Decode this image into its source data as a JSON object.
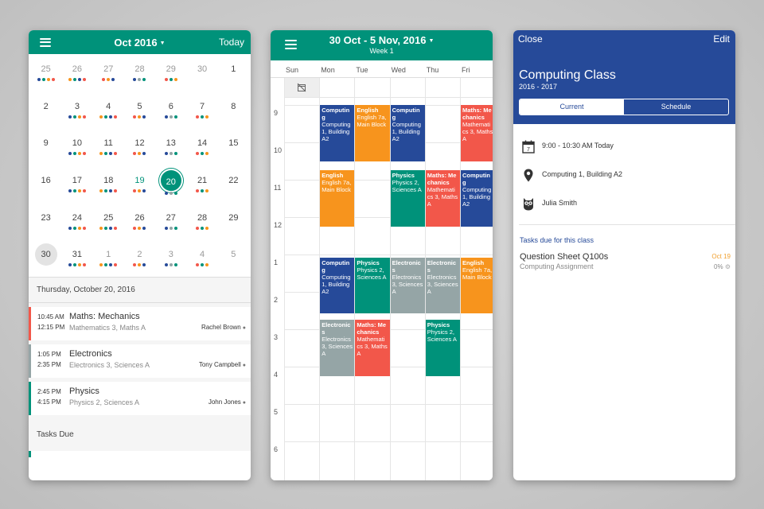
{
  "colors": {
    "teal": "#00927a",
    "navy": "#264a99",
    "orange": "#f7941d",
    "red": "#f2574a",
    "green": "#00927a",
    "grey": "#95a5a6",
    "blue": "#264a99"
  },
  "month_view": {
    "title": "Oct 2016",
    "today_label": "Today",
    "days": [
      {
        "n": "25",
        "other": true,
        "dots": [
          "#264a99",
          "#00927a",
          "#f7941d",
          "#f2574a"
        ]
      },
      {
        "n": "26",
        "other": true,
        "dots": [
          "#f7941d",
          "#00927a",
          "#264a99",
          "#f2574a"
        ]
      },
      {
        "n": "27",
        "other": true,
        "dots": [
          "#f2574a",
          "#f7941d",
          "#264a99"
        ]
      },
      {
        "n": "28",
        "other": true,
        "dots": [
          "#264a99",
          "#95a5a6",
          "#00927a"
        ]
      },
      {
        "n": "29",
        "other": true,
        "dots": [
          "#f2574a",
          "#00927a",
          "#f7941d"
        ]
      },
      {
        "n": "30",
        "other": true,
        "dots": []
      },
      {
        "n": "1",
        "other": false,
        "dots": []
      },
      {
        "n": "2",
        "dots": []
      },
      {
        "n": "3",
        "dots": [
          "#264a99",
          "#00927a",
          "#f7941d",
          "#f2574a"
        ]
      },
      {
        "n": "4",
        "dots": [
          "#f7941d",
          "#00927a",
          "#264a99",
          "#f2574a"
        ]
      },
      {
        "n": "5",
        "dots": [
          "#f2574a",
          "#f7941d",
          "#264a99"
        ]
      },
      {
        "n": "6",
        "dots": [
          "#264a99",
          "#95a5a6",
          "#00927a"
        ]
      },
      {
        "n": "7",
        "dots": [
          "#f2574a",
          "#00927a",
          "#f7941d"
        ]
      },
      {
        "n": "8",
        "dots": []
      },
      {
        "n": "9",
        "dots": []
      },
      {
        "n": "10",
        "dots": [
          "#264a99",
          "#00927a",
          "#f7941d",
          "#f2574a"
        ]
      },
      {
        "n": "11",
        "dots": [
          "#f7941d",
          "#00927a",
          "#264a99",
          "#f2574a"
        ]
      },
      {
        "n": "12",
        "dots": [
          "#f2574a",
          "#f7941d",
          "#264a99"
        ]
      },
      {
        "n": "13",
        "dots": [
          "#264a99",
          "#95a5a6",
          "#00927a"
        ]
      },
      {
        "n": "14",
        "dots": [
          "#f2574a",
          "#00927a",
          "#f7941d"
        ]
      },
      {
        "n": "15",
        "dots": []
      },
      {
        "n": "16",
        "dots": []
      },
      {
        "n": "17",
        "dots": [
          "#264a99",
          "#00927a",
          "#f7941d",
          "#f2574a"
        ]
      },
      {
        "n": "18",
        "dots": [
          "#f7941d",
          "#00927a",
          "#264a99",
          "#f2574a"
        ]
      },
      {
        "n": "19",
        "accent": true,
        "dots": [
          "#f2574a",
          "#f7941d",
          "#264a99"
        ]
      },
      {
        "n": "20",
        "selected": true,
        "dots": [
          "#264a99",
          "#95a5a6",
          "#00927a"
        ]
      },
      {
        "n": "21",
        "dots": [
          "#f2574a",
          "#00927a",
          "#f7941d"
        ]
      },
      {
        "n": "22",
        "dots": []
      },
      {
        "n": "23",
        "dots": []
      },
      {
        "n": "24",
        "dots": [
          "#264a99",
          "#00927a",
          "#f7941d",
          "#f2574a"
        ]
      },
      {
        "n": "25",
        "dots": [
          "#f7941d",
          "#00927a",
          "#264a99",
          "#f2574a"
        ]
      },
      {
        "n": "26",
        "dots": [
          "#f2574a",
          "#f7941d",
          "#264a99"
        ]
      },
      {
        "n": "27",
        "dots": [
          "#264a99",
          "#95a5a6",
          "#00927a"
        ]
      },
      {
        "n": "28",
        "dots": [
          "#f2574a",
          "#00927a",
          "#f7941d"
        ]
      },
      {
        "n": "29",
        "dots": []
      },
      {
        "n": "30",
        "grey": true,
        "dots": []
      },
      {
        "n": "31",
        "dots": [
          "#264a99",
          "#00927a",
          "#f7941d",
          "#f2574a"
        ]
      },
      {
        "n": "1",
        "other": true,
        "dots": [
          "#f7941d",
          "#00927a",
          "#264a99",
          "#f2574a"
        ]
      },
      {
        "n": "2",
        "other": true,
        "dots": [
          "#f2574a",
          "#f7941d",
          "#264a99"
        ]
      },
      {
        "n": "3",
        "other": true,
        "dots": [
          "#264a99",
          "#95a5a6",
          "#00927a"
        ]
      },
      {
        "n": "4",
        "other": true,
        "dots": [
          "#f2574a",
          "#00927a",
          "#f7941d"
        ]
      },
      {
        "n": "5",
        "other": true,
        "dots": []
      }
    ],
    "date_heading": "Thursday, October 20, 2016",
    "events": [
      {
        "start": "10:45 AM",
        "end": "12:15 PM",
        "title": "Maths: Mechanics",
        "sub": "Mathematics 3, Maths A",
        "teacher": "Rachel Brown",
        "color": "#f2574a"
      },
      {
        "start": "1:05 PM",
        "end": "2:35 PM",
        "title": "Electronics",
        "sub": "Electronics 3, Sciences A",
        "teacher": "Tony Campbell",
        "color": "#95a5a6"
      },
      {
        "start": "2:45 PM",
        "end": "4:15 PM",
        "title": "Physics",
        "sub": "Physics 2, Sciences A",
        "teacher": "John Jones",
        "color": "#00927a"
      }
    ],
    "tasks_due_label": "Tasks Due"
  },
  "week_view": {
    "title": "30 Oct - 5 Nov, 2016",
    "subtitle": "Week 1",
    "days": [
      "Sun",
      "Mon",
      "Tue",
      "Wed",
      "Thu",
      "Fri"
    ],
    "hours": [
      "9",
      "10",
      "11",
      "12",
      "1",
      "2",
      "3",
      "4",
      "5",
      "6"
    ],
    "blocks": [
      {
        "day": 1,
        "start": 9,
        "end": 10.5,
        "color": "#264a99",
        "title": "Computin g",
        "sub": "Computing 1, Building A2"
      },
      {
        "day": 2,
        "start": 9,
        "end": 10.5,
        "color": "#f7941d",
        "title": "English",
        "sub": "English 7a, Main Block"
      },
      {
        "day": 3,
        "start": 9,
        "end": 10.5,
        "color": "#264a99",
        "title": "Computin g",
        "sub": "Computing 1, Building A2"
      },
      {
        "day": 5,
        "start": 9,
        "end": 10.5,
        "color": "#f2574a",
        "title": "Maths: Me chanics",
        "sub": "Mathemati cs 3, Maths A"
      },
      {
        "day": 1,
        "start": 10.75,
        "end": 12.25,
        "color": "#f7941d",
        "title": "English",
        "sub": "English 7a, Main Block"
      },
      {
        "day": 3,
        "start": 10.75,
        "end": 12.25,
        "color": "#00927a",
        "title": "Physics",
        "sub": "Physics 2, Sciences A"
      },
      {
        "day": 4,
        "start": 10.75,
        "end": 12.25,
        "color": "#f2574a",
        "title": "Maths: Me chanics",
        "sub": "Mathemati cs 3, Maths A"
      },
      {
        "day": 5,
        "start": 10.75,
        "end": 12.25,
        "color": "#264a99",
        "title": "Computin g",
        "sub": "Computing 1, Building A2"
      },
      {
        "day": 1,
        "start": 13.08,
        "end": 14.58,
        "color": "#264a99",
        "title": "Computin g",
        "sub": "Computing 1, Building A2"
      },
      {
        "day": 2,
        "start": 13.08,
        "end": 14.58,
        "color": "#00927a",
        "title": "Physics",
        "sub": "Physics 2, Sciences A"
      },
      {
        "day": 3,
        "start": 13.08,
        "end": 14.58,
        "color": "#95a5a6",
        "title": "Electronic s",
        "sub": "Electronics 3, Sciences A"
      },
      {
        "day": 4,
        "start": 13.08,
        "end": 14.58,
        "color": "#95a5a6",
        "title": "Electronic s",
        "sub": "Electronics 3, Sciences A"
      },
      {
        "day": 5,
        "start": 13.08,
        "end": 14.58,
        "color": "#f7941d",
        "title": "English",
        "sub": "English 7a, Main Block"
      },
      {
        "day": 1,
        "start": 14.75,
        "end": 16.25,
        "color": "#95a5a6",
        "title": "Electronic s",
        "sub": "Electronics 3, Sciences A"
      },
      {
        "day": 2,
        "start": 14.75,
        "end": 16.25,
        "color": "#f2574a",
        "title": "Maths: Me chanics",
        "sub": "Mathemati cs 3, Maths A"
      },
      {
        "day": 4,
        "start": 14.75,
        "end": 16.25,
        "color": "#00927a",
        "title": "Physics",
        "sub": "Physics 2, Sciences A"
      }
    ]
  },
  "class_view": {
    "close_label": "Close",
    "edit_label": "Edit",
    "title": "Computing Class",
    "years": "2016 - 2017",
    "segments": [
      "Current",
      "Schedule"
    ],
    "time": "9:00 - 10:30 AM Today",
    "calendar_day": "7",
    "location": "Computing 1, Building A2",
    "teacher": "Julia Smith",
    "tasks_label": "Tasks due for this class",
    "task": {
      "title": "Question Sheet Q100s",
      "sub": "Computing Assignment",
      "due": "Oct 19",
      "progress": "0%",
      "progress_value": 0
    }
  }
}
